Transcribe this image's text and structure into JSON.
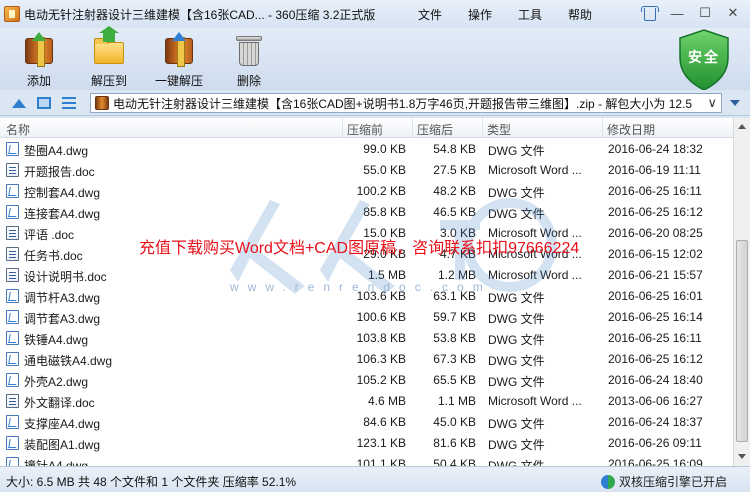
{
  "window": {
    "title": "电动无针注射器设计三维建模【含16张CAD... - 360压缩 3.2正式版"
  },
  "menu": [
    {
      "label": "文件"
    },
    {
      "label": "操作"
    },
    {
      "label": "工具"
    },
    {
      "label": "帮助"
    }
  ],
  "toolbar": {
    "add": "添加",
    "extract": "解压到",
    "one_click": "一键解压",
    "delete": "删除"
  },
  "security": {
    "label": "安全"
  },
  "address": {
    "path": "电动无针注射器设计三维建模【含16张CAD图+说明书1.8万字46页,开题报告带三维图】.zip - 解包大小为 12.5"
  },
  "columns": {
    "name": "名称",
    "packed": "压缩前",
    "unpacked": "压缩后",
    "type": "类型",
    "modified": "修改日期"
  },
  "files": [
    {
      "name": "垫圈A4.dwg",
      "before": "99.0 KB",
      "after": "54.8 KB",
      "type": "DWG 文件",
      "date": "2016-06-24 18:32",
      "icon": "dwg"
    },
    {
      "name": "开题报告.doc",
      "before": "55.0 KB",
      "after": "27.5 KB",
      "type": "Microsoft Word ...",
      "date": "2016-06-19 11:11",
      "icon": "doc"
    },
    {
      "name": "控制套A4.dwg",
      "before": "100.2 KB",
      "after": "48.2 KB",
      "type": "DWG 文件",
      "date": "2016-06-25 16:11",
      "icon": "dwg"
    },
    {
      "name": "连接套A4.dwg",
      "before": "85.8 KB",
      "after": "46.5 KB",
      "type": "DWG 文件",
      "date": "2016-06-25 16:12",
      "icon": "dwg"
    },
    {
      "name": "评语 .doc",
      "before": "15.0 KB",
      "after": "3.0 KB",
      "type": "Microsoft Word ...",
      "date": "2016-06-20 08:25",
      "icon": "doc"
    },
    {
      "name": "任务书.doc",
      "before": "29.0 KB",
      "after": "4.7 KB",
      "type": "Microsoft Word ...",
      "date": "2016-06-15 12:02",
      "icon": "doc"
    },
    {
      "name": "设计说明书.doc",
      "before": "1.5 MB",
      "after": "1.2 MB",
      "type": "Microsoft Word ...",
      "date": "2016-06-21 15:57",
      "icon": "doc"
    },
    {
      "name": "调节杆A3.dwg",
      "before": "103.6 KB",
      "after": "63.1 KB",
      "type": "DWG 文件",
      "date": "2016-06-25 16:01",
      "icon": "dwg"
    },
    {
      "name": "调节套A3.dwg",
      "before": "100.6 KB",
      "after": "59.7 KB",
      "type": "DWG 文件",
      "date": "2016-06-25 16:14",
      "icon": "dwg"
    },
    {
      "name": "铁锤A4.dwg",
      "before": "103.8 KB",
      "after": "53.8 KB",
      "type": "DWG 文件",
      "date": "2016-06-25 16:11",
      "icon": "dwg"
    },
    {
      "name": "通电磁铁A4.dwg",
      "before": "106.3 KB",
      "after": "67.3 KB",
      "type": "DWG 文件",
      "date": "2016-06-25 16:12",
      "icon": "dwg"
    },
    {
      "name": "外壳A2.dwg",
      "before": "105.2 KB",
      "after": "65.5 KB",
      "type": "DWG 文件",
      "date": "2016-06-24 18:40",
      "icon": "dwg"
    },
    {
      "name": "外文翻译.doc",
      "before": "4.6 MB",
      "after": "1.1 MB",
      "type": "Microsoft Word ...",
      "date": "2013-06-06 16:27",
      "icon": "doc"
    },
    {
      "name": "支撑座A4.dwg",
      "before": "84.6 KB",
      "after": "45.0 KB",
      "type": "DWG 文件",
      "date": "2016-06-24 18:37",
      "icon": "dwg"
    },
    {
      "name": "装配图A1.dwg",
      "before": "123.1 KB",
      "after": "81.6 KB",
      "type": "DWG 文件",
      "date": "2016-06-26 09:11",
      "icon": "dwg"
    },
    {
      "name": "撞针A4.dwg",
      "before": "101.1 KB",
      "after": "50.4 KB",
      "type": "DWG 文件",
      "date": "2016-06-25 16:09",
      "icon": "dwg"
    }
  ],
  "promo": "充值下载购买Word文档+CAD图原稿，咨询联系扣扣97666224",
  "watermark_url": "www.renrendoc.com",
  "status": {
    "summary": "大小: 6.5 MB 共 48 个文件和 1 个文件夹 压缩率 52.1%",
    "engine": "双核压缩引擎已开启"
  }
}
